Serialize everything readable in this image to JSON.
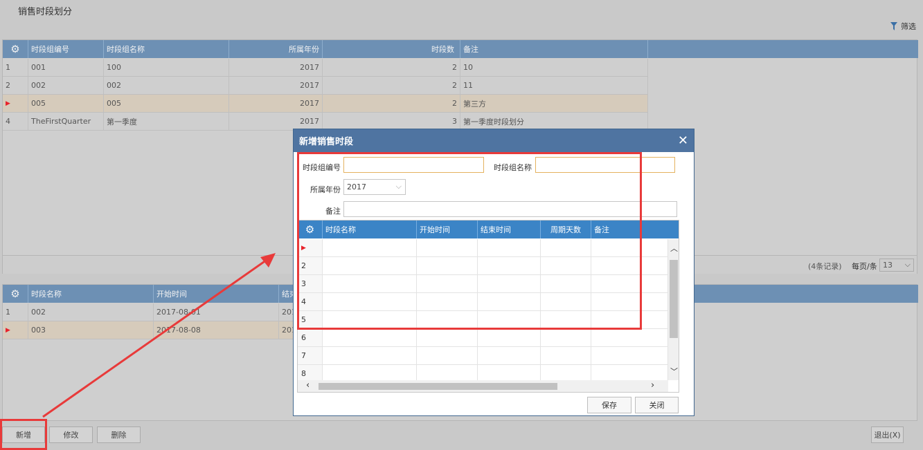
{
  "page": {
    "title": "销售时段划分",
    "filter_label": "筛选"
  },
  "top_grid": {
    "columns": [
      "时段组编号",
      "时段组名称",
      "所属年份",
      "时段数",
      "备注"
    ],
    "rows": [
      {
        "idx": "1",
        "code": "001",
        "name": "100",
        "year": "2017",
        "count": "2",
        "note": "10",
        "selected": false
      },
      {
        "idx": "2",
        "code": "002",
        "name": "002",
        "year": "2017",
        "count": "2",
        "note": "11",
        "selected": false
      },
      {
        "idx": "",
        "code": "005",
        "name": "005",
        "year": "2017",
        "count": "2",
        "note": "第三方",
        "selected": true
      },
      {
        "idx": "4",
        "code": "TheFirstQuarter",
        "name": "第一季度",
        "year": "2017",
        "count": "3",
        "note": "第一季度时段划分",
        "selected": false
      }
    ],
    "footer": {
      "record_count": "(4条记录)",
      "per_page_label": "每页/条",
      "per_page_value": "13"
    }
  },
  "bottom_grid": {
    "columns": [
      "时段名称",
      "开始时间",
      "结束"
    ],
    "rows": [
      {
        "idx": "1",
        "name": "002",
        "start": "2017-08-01",
        "end": "201",
        "selected": false
      },
      {
        "idx": "",
        "name": "003",
        "start": "2017-08-08",
        "end": "201",
        "selected": true
      }
    ]
  },
  "buttons": {
    "add": "新增",
    "edit": "修改",
    "delete": "删除",
    "exit": "退出(X)"
  },
  "dialog": {
    "title": "新增销售时段",
    "fields": {
      "group_code_label": "时段组编号",
      "group_code_value": "",
      "group_name_label": "时段组名称",
      "group_name_value": "",
      "year_label": "所属年份",
      "year_value": "2017",
      "note_label": "备注",
      "note_value": ""
    },
    "grid": {
      "columns": [
        "时段名称",
        "开始时间",
        "结束时间",
        "周期天数",
        "备注"
      ],
      "row_indices": [
        "",
        "2",
        "3",
        "4",
        "5",
        "6",
        "7",
        "8"
      ]
    },
    "save_label": "保存",
    "close_label": "关闭"
  },
  "colors": {
    "annotation_red": "#e83a3a",
    "header_blue": "#3b84c6",
    "selected_row": "#d6cbbb"
  }
}
